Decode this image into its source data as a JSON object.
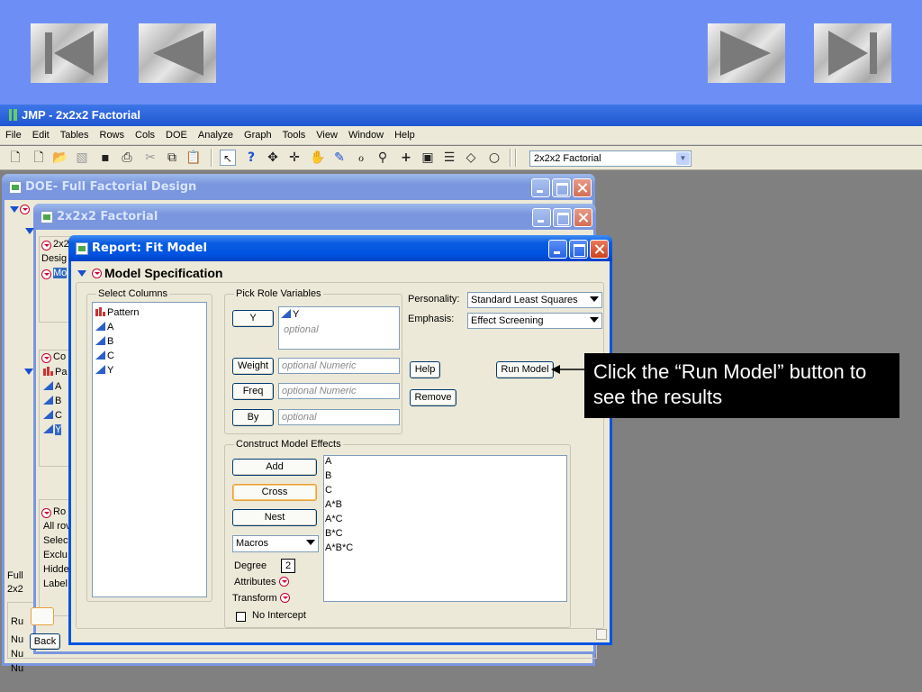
{
  "nav": {
    "first": "first-slide",
    "prev": "previous-slide",
    "next": "next-slide",
    "last": "last-slide"
  },
  "app": {
    "title": "JMP - 2x2x2 Factorial",
    "menu": [
      "File",
      "Edit",
      "Tables",
      "Rows",
      "Cols",
      "DOE",
      "Analyze",
      "Graph",
      "Tools",
      "View",
      "Window",
      "Help"
    ],
    "toolbar_select": "2x2x2 Factorial"
  },
  "doe_window": {
    "title": "DOE- Full Factorial Design",
    "left_labels": [
      "Full",
      "2x2"
    ],
    "left_row_labels": [
      "Ru",
      "Nu",
      "Nu",
      "Nu"
    ],
    "back_button": "Back"
  },
  "table_window": {
    "title": "2x2x2 Factorial",
    "top_item": "2x2",
    "design_label": "Desig",
    "model_item": "Mo",
    "cols_header": "Co",
    "cols": [
      "Pa",
      "A",
      "B",
      "C",
      "Y"
    ],
    "rows_header": "Ro",
    "rows_items": [
      "All rov",
      "Select",
      "Exclu",
      "Hidde",
      "Label"
    ]
  },
  "fit_model": {
    "title": "Report: Fit Model",
    "section": "Model Specification",
    "select_columns_label": "Select Columns",
    "columns": [
      {
        "name": "Pattern",
        "icon": "nominal-bars-icon"
      },
      {
        "name": "A",
        "icon": "continuous-triangle-icon"
      },
      {
        "name": "B",
        "icon": "continuous-triangle-icon"
      },
      {
        "name": "C",
        "icon": "continuous-triangle-icon"
      },
      {
        "name": "Y",
        "icon": "continuous-triangle-icon"
      }
    ],
    "pick_role_label": "Pick Role Variables",
    "y_button": "Y",
    "y_value": "Y",
    "y_placeholder": "optional",
    "weight_button": "Weight",
    "weight_placeholder": "optional Numeric",
    "freq_button": "Freq",
    "freq_placeholder": "optional Numeric",
    "by_button": "By",
    "by_placeholder": "optional",
    "personality_label": "Personality:",
    "personality_value": "Standard Least Squares",
    "emphasis_label": "Emphasis:",
    "emphasis_value": "Effect Screening",
    "help_button": "Help",
    "run_model_button": "Run Model",
    "remove_button": "Remove",
    "construct_label": "Construct Model Effects",
    "add_button": "Add",
    "cross_button": "Cross",
    "nest_button": "Nest",
    "macros_value": "Macros",
    "degree_label": "Degree",
    "degree_value": "2",
    "attributes_label": "Attributes",
    "transform_label": "Transform",
    "no_intercept_label": "No Intercept",
    "effects": [
      "A",
      "B",
      "C",
      "A*B",
      "A*C",
      "B*C",
      "A*B*C"
    ]
  },
  "callout": {
    "text": "Click the “Run Model” button to see the results"
  }
}
